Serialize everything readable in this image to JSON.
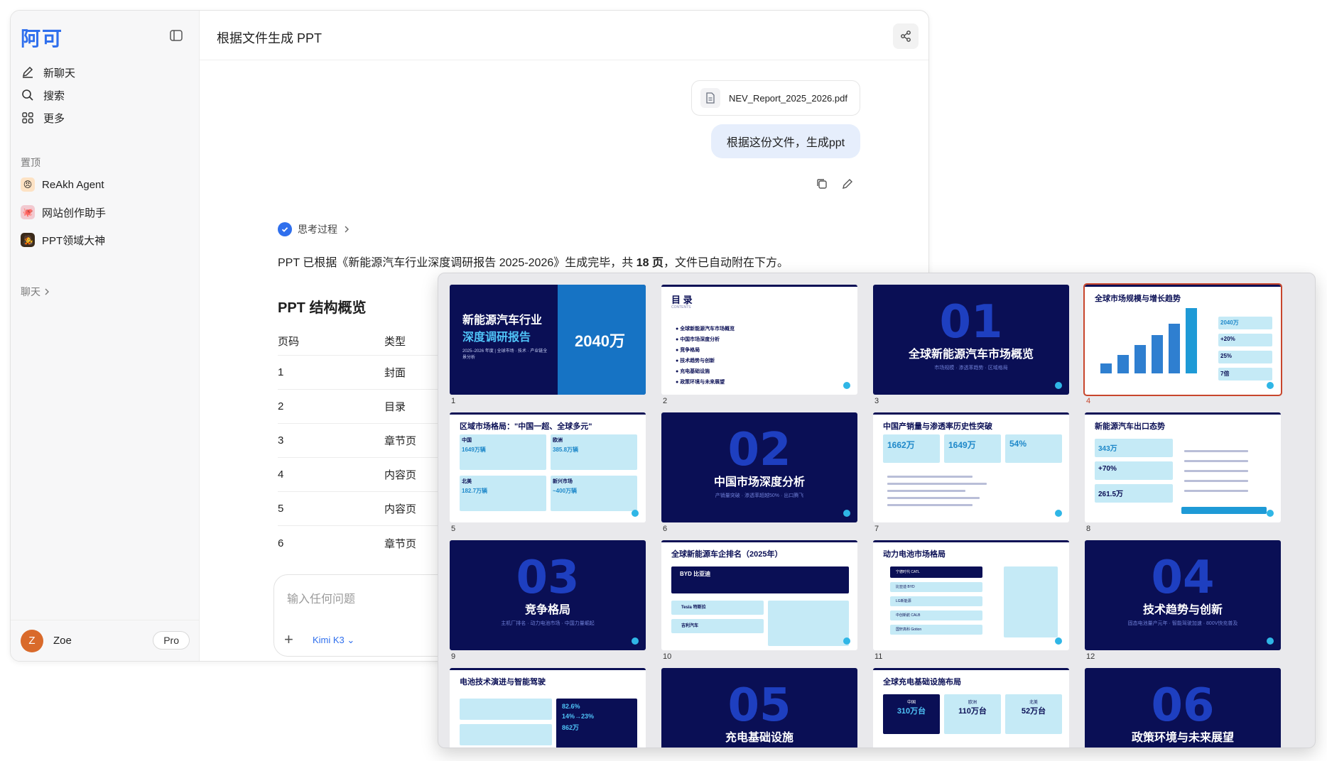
{
  "sidebar": {
    "logo": "阿可",
    "nav": [
      {
        "label": "新聊天",
        "icon": "edit-icon"
      },
      {
        "label": "搜索",
        "icon": "search-icon"
      },
      {
        "label": "更多",
        "icon": "grid-icon"
      }
    ],
    "pinned_label": "置顶",
    "pinned": [
      {
        "label": "ReAkh Agent",
        "emoji": "😠"
      },
      {
        "label": "网站创作助手",
        "emoji": "🐙"
      },
      {
        "label": "PPT领域大神",
        "emoji": "🧑‍🎤"
      }
    ],
    "chats_label": "聊天",
    "user": {
      "initial": "Z",
      "name": "Zoe",
      "plan": "Pro"
    }
  },
  "header": {
    "title": "根据文件生成 PPT"
  },
  "conversation": {
    "file_name": "NEV_Report_2025_2026.pdf",
    "user_message": "根据这份文件，生成ppt",
    "thinking_label": "思考过程",
    "answer_prefix": "PPT 已根据《新能源汽车行业深度调研报告 2025-2026》生成完毕，共 ",
    "answer_pages": "18 页",
    "answer_suffix": "，文件已自动附在下方。",
    "structure_title": "PPT 结构概览",
    "table": {
      "headers": [
        "页码",
        "类型"
      ],
      "rows": [
        [
          "1",
          "封面"
        ],
        [
          "2",
          "目录"
        ],
        [
          "3",
          "章节页"
        ],
        [
          "4",
          "内容页"
        ],
        [
          "5",
          "内容页"
        ],
        [
          "6",
          "章节页"
        ]
      ]
    }
  },
  "composer": {
    "placeholder": "输入任何问题",
    "model": "Kimi K3"
  },
  "slides": {
    "cover": {
      "title1": "新能源汽车行业",
      "title2": "深度调研报告",
      "sub": "2025–2026 年度 | 全球市场 · 技术 · 产业链全景分析",
      "big": "2040万"
    },
    "toc": {
      "title": "目 录",
      "en": "CONTENTS",
      "items": [
        "全球新能源汽车市场概览",
        "中国市场深度分析",
        "竞争格局",
        "技术趋势与创新",
        "充电基础设施",
        "政策环境与未来展望"
      ]
    },
    "sections": [
      {
        "num": "01",
        "title": "全球新能源汽车市场概览",
        "sub": "市场规模 · 渗透率趋势 · 区域格局"
      },
      {
        "num": "02",
        "title": "中国市场深度分析",
        "sub": "产销量突破 · 渗透率超越50% · 出口腾飞"
      },
      {
        "num": "03",
        "title": "竞争格局",
        "sub": "主机厂排名 · 动力电池市场 · 中国力量崛起"
      },
      {
        "num": "04",
        "title": "技术趋势与创新",
        "sub": "固态电池量产元年 · 智能驾驶加速 · 800V快充普及"
      },
      {
        "num": "05",
        "title": "充电基础设施",
        "sub": ""
      },
      {
        "num": "06",
        "title": "政策环境与未来展望",
        "sub": ""
      }
    ],
    "s4": {
      "title": "全球市场规模与增长趋势",
      "stats": [
        "2040万",
        "+20%",
        "25%",
        "7倍"
      ],
      "bars": [
        0.12,
        0.22,
        0.34,
        0.46,
        0.6,
        0.82
      ]
    },
    "s5": {
      "title": "区域市场格局：\"中国一超、全球多元\"",
      "cards": [
        {
          "name": "中国",
          "val": "1649万辆"
        },
        {
          "name": "欧洲",
          "val": "385.8万辆"
        },
        {
          "name": "北美",
          "val": "182.7万辆"
        },
        {
          "name": "新兴市场",
          "val": "~400万辆"
        }
      ]
    },
    "s7": {
      "title": "中国产销量与渗透率历史性突破",
      "stats": [
        "1662万",
        "1649万",
        "54%"
      ]
    },
    "s8": {
      "title": "新能源汽车出口态势",
      "stats": [
        "343万",
        "+70%",
        "261.5万"
      ]
    },
    "s10": {
      "title": "全球新能源车企排名（2025年）",
      "top": "BYD 比亚迪",
      "rows": [
        "Tesla 特斯拉",
        "吉利汽车"
      ]
    },
    "s11": {
      "title": "动力电池市场格局",
      "rows": [
        "宁德时代 CATL",
        "比亚迪 BYD",
        "LG新能源",
        "中创新航 CALB",
        "国轩高科 Gotion"
      ]
    },
    "s13": {
      "title": "电池技术演进与智能驾驶",
      "stats": [
        "82.6%",
        "14%→23%",
        "862万"
      ]
    },
    "s15": {
      "title": "全球充电基础设施布局",
      "stats": [
        "310万台",
        "110万台",
        "52万台"
      ],
      "regions": [
        "中国",
        "欧洲",
        "北美"
      ]
    }
  }
}
